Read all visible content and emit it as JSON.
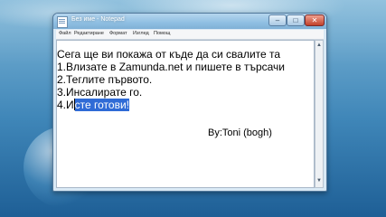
{
  "window": {
    "title": "Без име - Notepad",
    "minimize_glyph": "–",
    "maximize_glyph": "□",
    "close_glyph": "✕",
    "app_icon": "notepad-icon"
  },
  "menu": {
    "items": [
      "Файл",
      "Редактиране",
      "Формат",
      "Изглед",
      "Помощ"
    ]
  },
  "document": {
    "lines": [
      "Сега ще ви покажа от къде да си свалите та",
      "1.Влизате в Zamunda.net и пишете в търсачи",
      "2.Теглите първото.",
      "3.Инсалирате го."
    ],
    "line4_prefix": "4.И",
    "line4_selected": "сте готови!",
    "signature": "By:Toni (bogh)"
  }
}
